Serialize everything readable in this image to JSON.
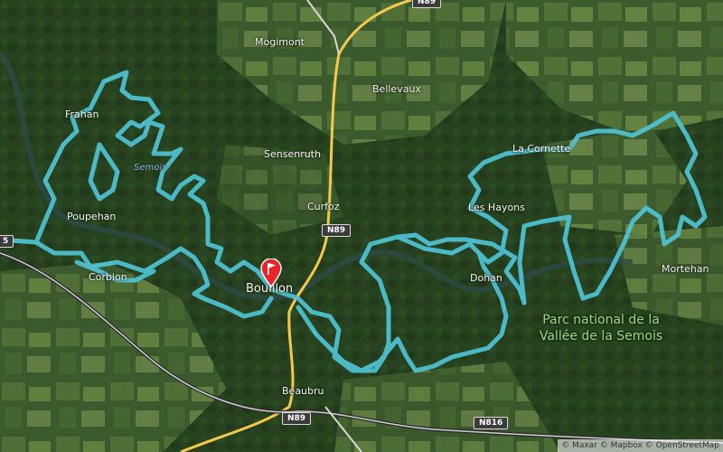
{
  "map": {
    "places": [
      {
        "id": "mogimont",
        "name": "Mogimont"
      },
      {
        "id": "bellevaux",
        "name": "Bellevaux"
      },
      {
        "id": "sensenruth",
        "name": "Sensenruth"
      },
      {
        "id": "curfoz",
        "name": "Curfoz"
      },
      {
        "id": "frahan",
        "name": "Frahan"
      },
      {
        "id": "poupehan",
        "name": "Poupehan"
      },
      {
        "id": "corbion",
        "name": "Corbion"
      },
      {
        "id": "bouillon",
        "name": "Bouillon"
      },
      {
        "id": "beaubru",
        "name": "Beaubru"
      },
      {
        "id": "dohan",
        "name": "Dohan"
      },
      {
        "id": "la-cornette",
        "name": "La Cornette"
      },
      {
        "id": "les-hayons",
        "name": "Les Hayons"
      },
      {
        "id": "mortehan",
        "name": "Mortehan"
      }
    ],
    "river_label": "Semois",
    "park_label_line1": "Parc national de la",
    "park_label_line2": "Vallée de la Semois",
    "road_shields": {
      "n89_north": "N89",
      "n89_south": "N89",
      "n816": "N816",
      "n_top": "N89",
      "left_edge": "5"
    },
    "attribution": "© Maxar © Mapbox © OpenStreetMap",
    "marker_icon": "flag-marker-icon",
    "colors": {
      "route": "#4fc3d6",
      "park": "#9ed686",
      "road": "#f2c94c",
      "marker": "#e8232a"
    }
  }
}
